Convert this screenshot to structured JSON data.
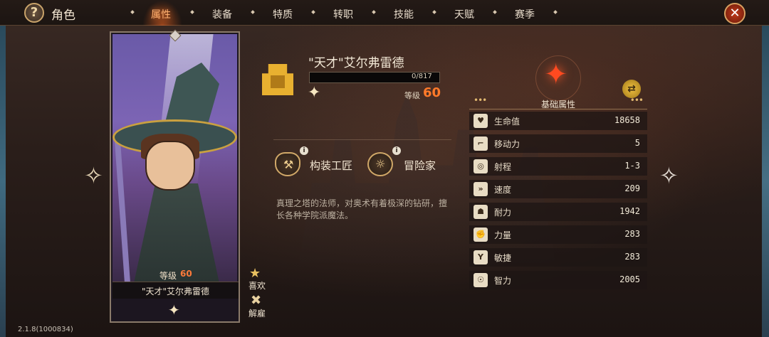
{
  "header": {
    "title": "角色",
    "tabs": [
      {
        "label": "属性",
        "active": true
      },
      {
        "label": "装备",
        "active": false
      },
      {
        "label": "特质",
        "active": false
      },
      {
        "label": "转职",
        "active": false
      },
      {
        "label": "技能",
        "active": false
      },
      {
        "label": "天赋",
        "active": false
      },
      {
        "label": "赛季",
        "active": false
      }
    ],
    "icons": {
      "help": "question-icon",
      "close": "close-icon"
    }
  },
  "card": {
    "level_label": "等级",
    "level_value": "60",
    "name": "\"天才\"艾尔弗雷德"
  },
  "side_actions": {
    "favorite_label": "喜欢",
    "dismiss_label": "解雇"
  },
  "hero": {
    "name": "\"天才\"艾尔弗雷德",
    "exp_text": "0/817",
    "exp_fraction": 0.0,
    "level_label": "等级",
    "level_value": "60",
    "class_label": "构装工匠",
    "role_label": "冒险家",
    "info_mark": "i",
    "description": "真理之塔的法师，对奥术有着极深的钻研，擅长各种学院派魔法。"
  },
  "stats": {
    "title": "基础属性",
    "rows": [
      {
        "icon": "heart-icon",
        "label": "生命值",
        "value": "18658"
      },
      {
        "icon": "boot-icon",
        "label": "移动力",
        "value": "5"
      },
      {
        "icon": "target-icon",
        "label": "射程",
        "value": "1-3"
      },
      {
        "icon": "speed-icon",
        "label": "速度",
        "value": "209"
      },
      {
        "icon": "endurance-icon",
        "label": "耐力",
        "value": "1942"
      },
      {
        "icon": "strength-icon",
        "label": "力量",
        "value": "283"
      },
      {
        "icon": "agility-icon",
        "label": "敏捷",
        "value": "283"
      },
      {
        "icon": "intellect-icon",
        "label": "智力",
        "value": "2005"
      }
    ]
  },
  "version": "2.1.8(1000834)",
  "colors": {
    "accent": "#ff7a2a",
    "active_tab": "#ffb070",
    "close": "#c23a1a"
  }
}
